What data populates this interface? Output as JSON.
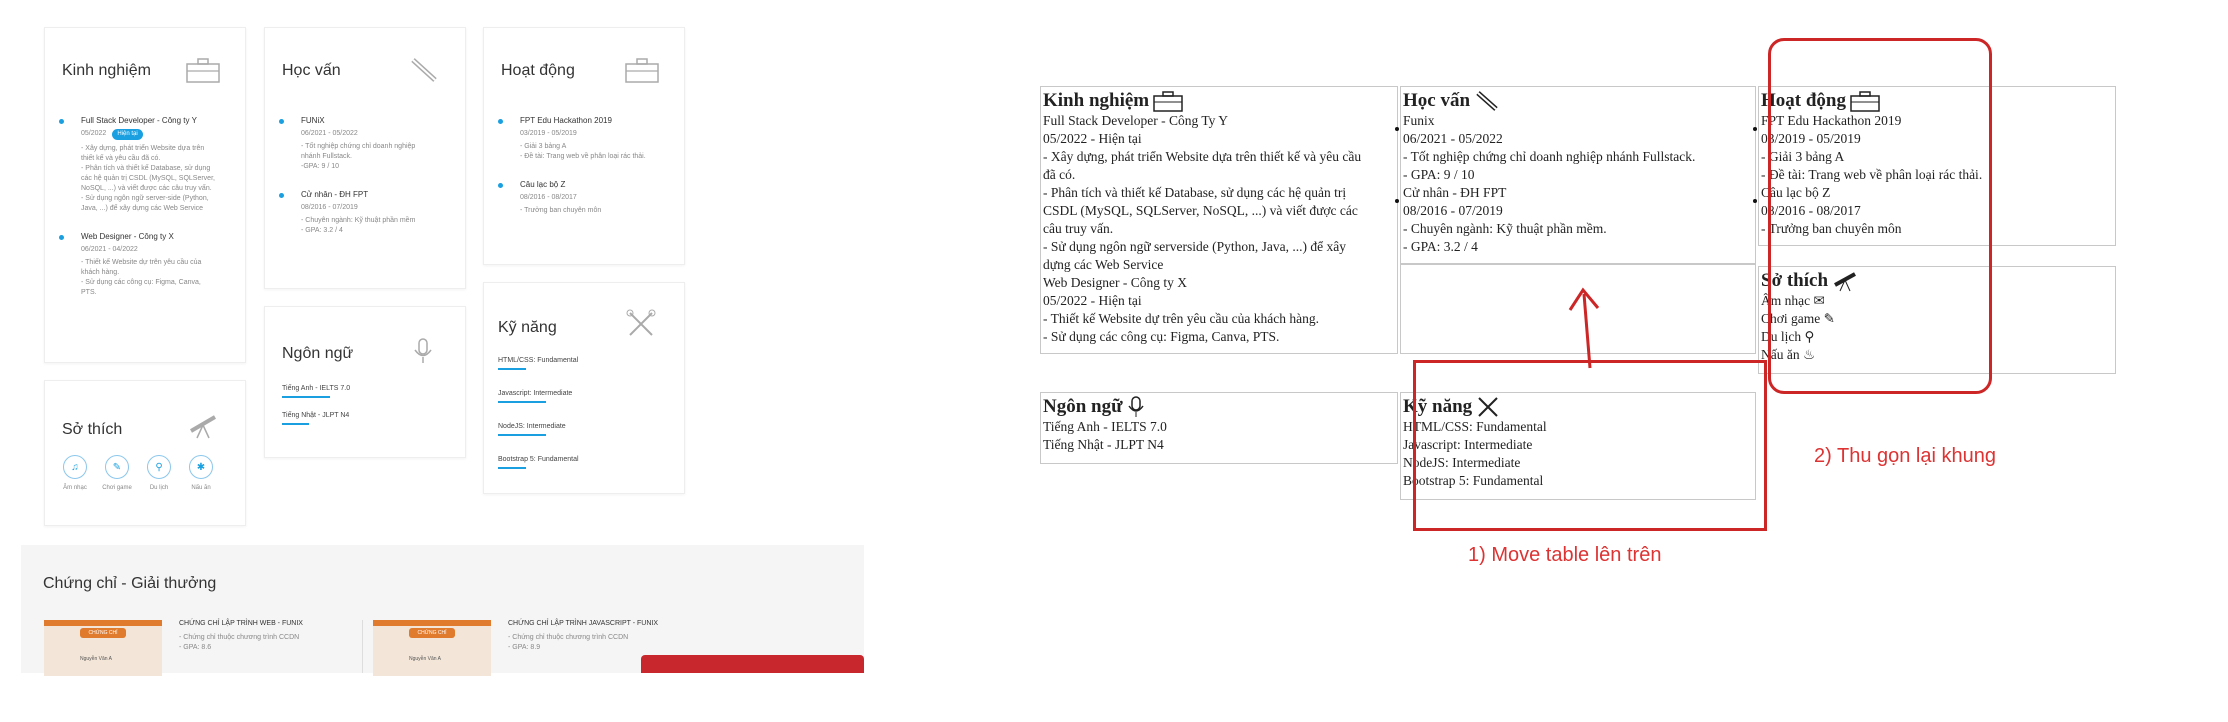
{
  "left": {
    "experience": {
      "title": "Kinh nghiệm",
      "items": [
        {
          "role": "Full Stack Developer - Công ty Y",
          "date": "05/2022",
          "badge": "Hiện tại",
          "desc": [
            "- Xây dựng, phát triển Website dựa trên",
            "thiết kế và yêu cầu đã có.",
            "- Phân tích và thiết kế Database, sử dụng",
            "các hệ quản trị CSDL (MySQL, SQLServer,",
            "NoSQL, ...) và viết được các câu truy vấn.",
            "- Sử dụng ngôn ngữ server-side (Python,",
            "Java, ...) để xây dựng các Web Service"
          ]
        },
        {
          "role": "Web Designer - Công ty X",
          "date": "06/2021 - 04/2022",
          "desc": [
            "- Thiết kế Website dự trên yêu cầu của",
            "khách hàng.",
            "- Sử dụng các công cụ: Figma, Canva,",
            "PTS."
          ]
        }
      ]
    },
    "education": {
      "title": "Học vấn",
      "items": [
        {
          "role": "FUNiX",
          "date": "06/2021 - 05/2022",
          "desc": [
            "- Tốt nghiệp chứng chỉ doanh nghiệp",
            "nhánh Fullstack.",
            "-GPA: 9 / 10"
          ]
        },
        {
          "role": "Cử nhân - ĐH FPT",
          "date": "08/2016 - 07/2019",
          "desc": [
            "- Chuyên ngành: Kỹ thuật phần mềm",
            "- GPA: 3.2 / 4"
          ]
        }
      ]
    },
    "activities": {
      "title": "Hoạt động",
      "items": [
        {
          "role": "FPT Edu Hackathon 2019",
          "date": "03/2019 - 05/2019",
          "desc": [
            "- Giải 3 bảng A",
            "- Đề tài: Trang web về phân loại rác thải."
          ]
        },
        {
          "role": "Câu lạc bộ Z",
          "date": "08/2016 - 08/2017",
          "desc": [
            "- Trưởng ban chuyên môn"
          ]
        }
      ]
    },
    "languages": {
      "title": "Ngôn ngữ",
      "items": [
        {
          "label": "Tiếng Anh - IELTS 7.0",
          "level": 0.8
        },
        {
          "label": "Tiếng Nhật - JLPT N4",
          "level": 0.45
        }
      ]
    },
    "skills": {
      "title": "Kỹ năng",
      "items": [
        "HTML/CSS: Fundamental",
        "Javascript: Intermediate",
        "NodeJS: Intermediate",
        "Bootstrap 5: Fundamental"
      ]
    },
    "hobbies": {
      "title": "Sở thích",
      "items": [
        "Âm nhạc",
        "Chơi game",
        "Du lịch",
        "Nấu ăn"
      ]
    },
    "certs": {
      "title": "Chứng chỉ - Giải thưởng",
      "items": [
        {
          "name": "CHỨNG CHỈ LẬP TRÌNH WEB - FUNIX",
          "desc": [
            "- Chứng chỉ thuộc chương trình CCDN",
            "- GPA: 8.6"
          ],
          "thumb_stamp": "CHỨNG CHỈ",
          "thumb_name": "Nguyễn Văn A"
        },
        {
          "name": "CHỨNG CHỈ LẬP TRÌNH JAVASCRIPT - FUNIX",
          "desc": [
            "- Chứng chỉ thuộc chương trình CCDN",
            "- GPA: 8.9"
          ],
          "thumb_stamp": "CHỨNG CHỈ",
          "thumb_name": "Nguyễn Văn A"
        }
      ]
    }
  },
  "right": {
    "experience": {
      "title": "Kinh nghiệm",
      "lines": [
        "Full Stack Developer - Công Ty Y",
        "05/2022 - Hiện tại",
        "- Xây dựng, phát triển Website dựa trên thiết kế và yêu cầu",
        "đã có.",
        "- Phân tích và thiết kế Database, sử dụng các hệ quản trị",
        "CSDL (MySQL, SQLServer, NoSQL, ...) và viết được các",
        "câu truy vấn.",
        "- Sử dụng ngôn ngữ serverside (Python, Java, ...) để xây",
        "dựng các Web Service",
        "Web Designer - Công ty X",
        "05/2022 - Hiện tại",
        "- Thiết kế Website dự trên yêu cầu của khách hàng.",
        "- Sử dụng các công cụ: Figma, Canva, PTS."
      ]
    },
    "education": {
      "title": "Học vấn",
      "lines": [
        "Funix",
        "06/2021 - 05/2022",
        "- Tốt nghiệp chứng chỉ doanh nghiệp nhánh Fullstack.",
        "- GPA: 9 / 10",
        "Cử nhân - ĐH FPT",
        "08/2016 - 07/2019",
        "- Chuyên ngành: Kỹ thuật phần mềm.",
        "- GPA: 3.2 / 4"
      ]
    },
    "activities": {
      "title": "Hoạt động",
      "lines": [
        "FPT Edu Hackathon 2019",
        "03/2019 - 05/2019",
        "- Giải 3 bảng A",
        "- Đề tài: Trang web về phân loại rác thải.",
        "Câu lạc bộ Z",
        "08/2016 - 08/2017",
        "- Trưởng ban chuyên môn"
      ]
    },
    "hobbies": {
      "title": "Sở thích",
      "lines": [
        "Âm nhạc",
        "Chơi game",
        "Du lịch",
        "Nấu ăn"
      ]
    },
    "languages": {
      "title": "Ngôn ngữ",
      "lines": [
        "Tiếng Anh - IELTS 7.0",
        "Tiếng Nhật - JLPT N4"
      ]
    },
    "skills": {
      "title": "Kỹ năng",
      "lines": [
        "HTML/CSS: Fundamental",
        "Javascript: Intermediate",
        "NodeJS: Intermediate",
        "Bootstrap 5: Fundamental"
      ]
    }
  },
  "annotations": {
    "move": "1) Move table lên trên",
    "shrink": "2) Thu gọn lại khung"
  },
  "colors": {
    "accent": "#1a9fe0",
    "annotation": "#cc2626"
  }
}
